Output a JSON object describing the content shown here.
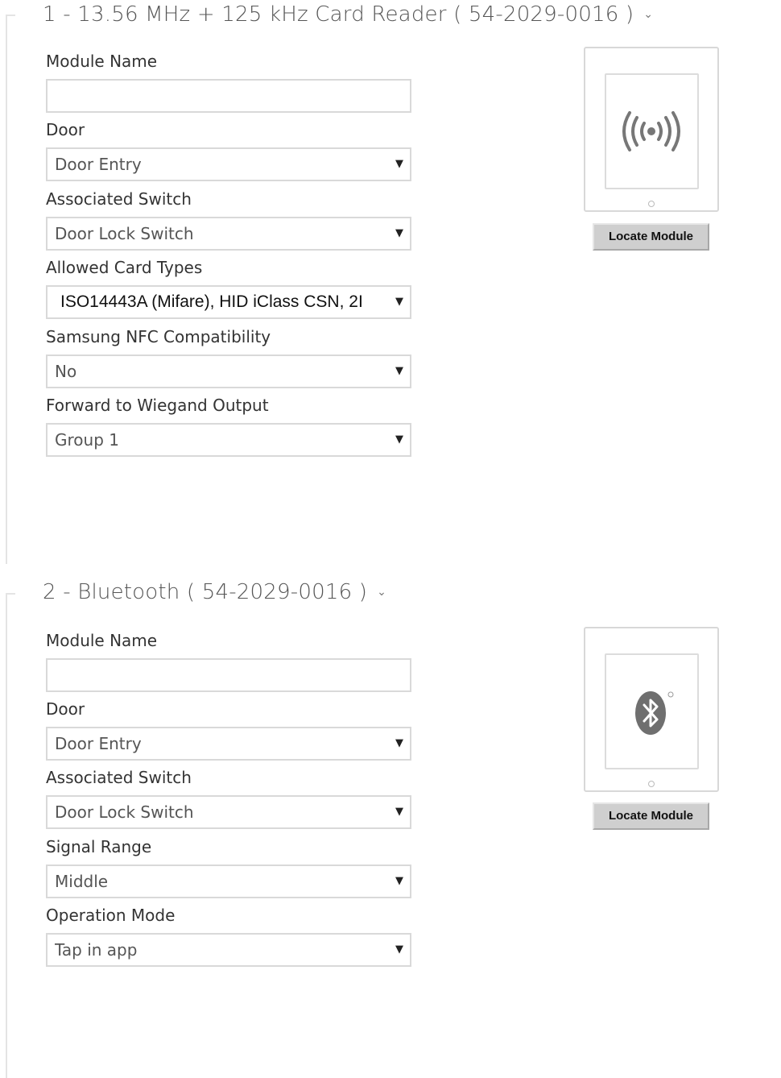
{
  "sections": [
    {
      "title": "1 - 13.56 MHz + 125 kHz Card Reader ( 54-2029-0016 )",
      "fields": [
        {
          "label": "Module Name",
          "type": "input",
          "value": ""
        },
        {
          "label": "Door",
          "type": "select",
          "value": "Door Entry"
        },
        {
          "label": "Associated Switch",
          "type": "select",
          "value": "Door Lock Switch"
        },
        {
          "label": "Allowed Card Types",
          "type": "select",
          "value": "ISO14443A (Mifare), HID iClass CSN, 2I"
        },
        {
          "label": "Samsung NFC Compatibility",
          "type": "select",
          "value": "No"
        },
        {
          "label": "Forward to Wiegand Output",
          "type": "select",
          "value": "Group 1"
        }
      ],
      "icon": "rfid-icon",
      "locate_label": "Locate Module"
    },
    {
      "title": "2 - Bluetooth ( 54-2029-0016 )",
      "fields": [
        {
          "label": "Module Name",
          "type": "input",
          "value": ""
        },
        {
          "label": "Door",
          "type": "select",
          "value": "Door Entry"
        },
        {
          "label": "Associated Switch",
          "type": "select",
          "value": "Door Lock Switch"
        },
        {
          "label": "Signal Range",
          "type": "select",
          "value": "Middle"
        },
        {
          "label": "Operation Mode",
          "type": "select",
          "value": "Tap in app"
        }
      ],
      "icon": "bluetooth-icon",
      "locate_label": "Locate Module"
    }
  ],
  "dropdown_arrow": "▼",
  "chevron": "⌄"
}
